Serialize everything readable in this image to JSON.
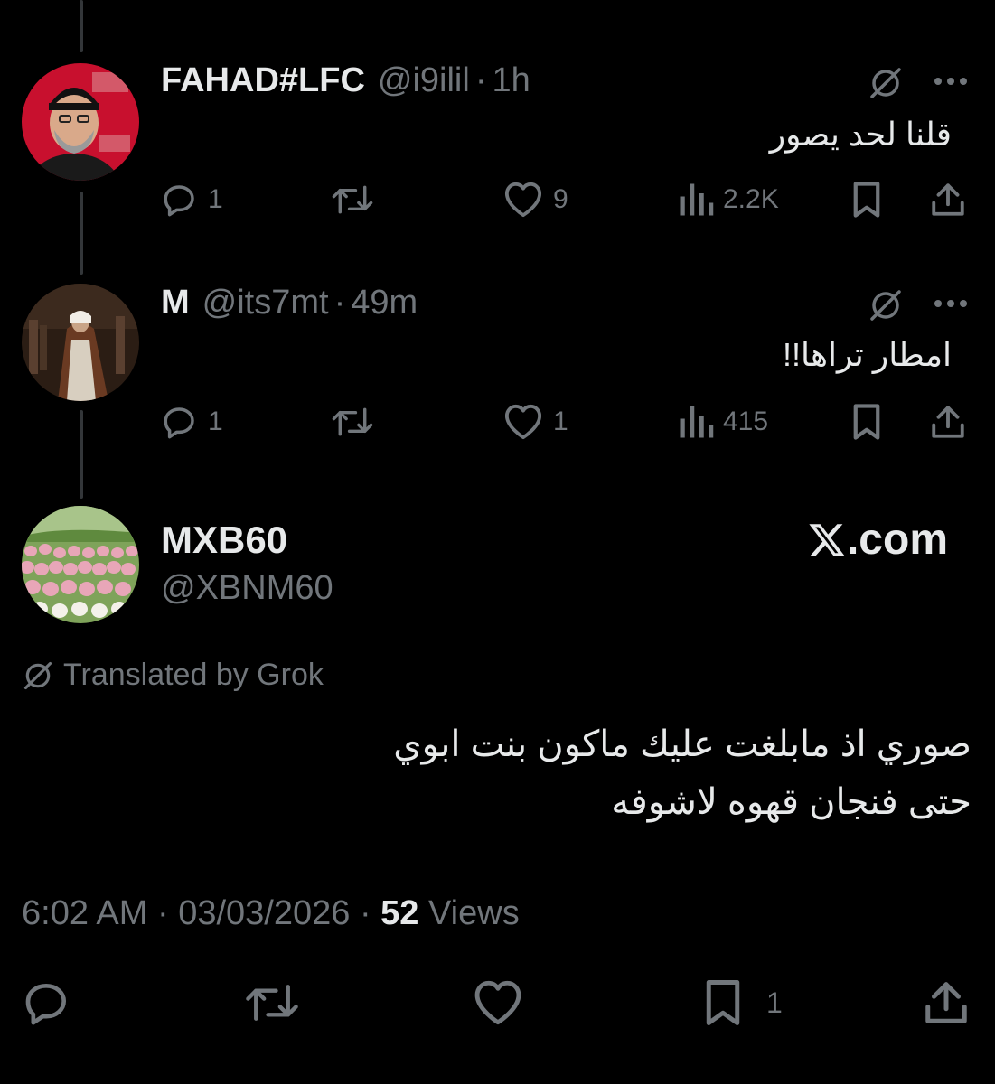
{
  "replies": [
    {
      "display_name": "FAHAD#LFC",
      "handle": "@i9ilil",
      "separator": "·",
      "time": "1h",
      "text": "قلنا لحد يصور",
      "reply_count": "1",
      "like_count": "9",
      "views": "2.2K",
      "avatar_icon": "avatar-man-red-background"
    },
    {
      "display_name": "M",
      "handle": "@its7mt",
      "separator": "·",
      "time": "49m",
      "text": "امطار تراها!!",
      "reply_count": "1",
      "like_count": "1",
      "views": "415",
      "avatar_icon": "avatar-man-in-robe"
    }
  ],
  "main_tweet": {
    "display_name": "MXB60",
    "handle": "@XBNM60",
    "brand": ".com",
    "translated_label": "Translated by Grok",
    "text_line1": "صوري اذ مابلغت عليك ماكون بنت ابوي",
    "text_line2": "حتى فنجان قهوه لاشوفه",
    "time": "6:02 AM",
    "separator": "·",
    "date": "03/03/2026",
    "views_count": "52",
    "views_label": "Views",
    "bookmark_count": "1",
    "avatar_icon": "avatar-tulip-field"
  },
  "colors": {
    "background": "#000000",
    "text": "#e7e9ea",
    "secondary": "#71767b",
    "thread_line": "#333639"
  }
}
